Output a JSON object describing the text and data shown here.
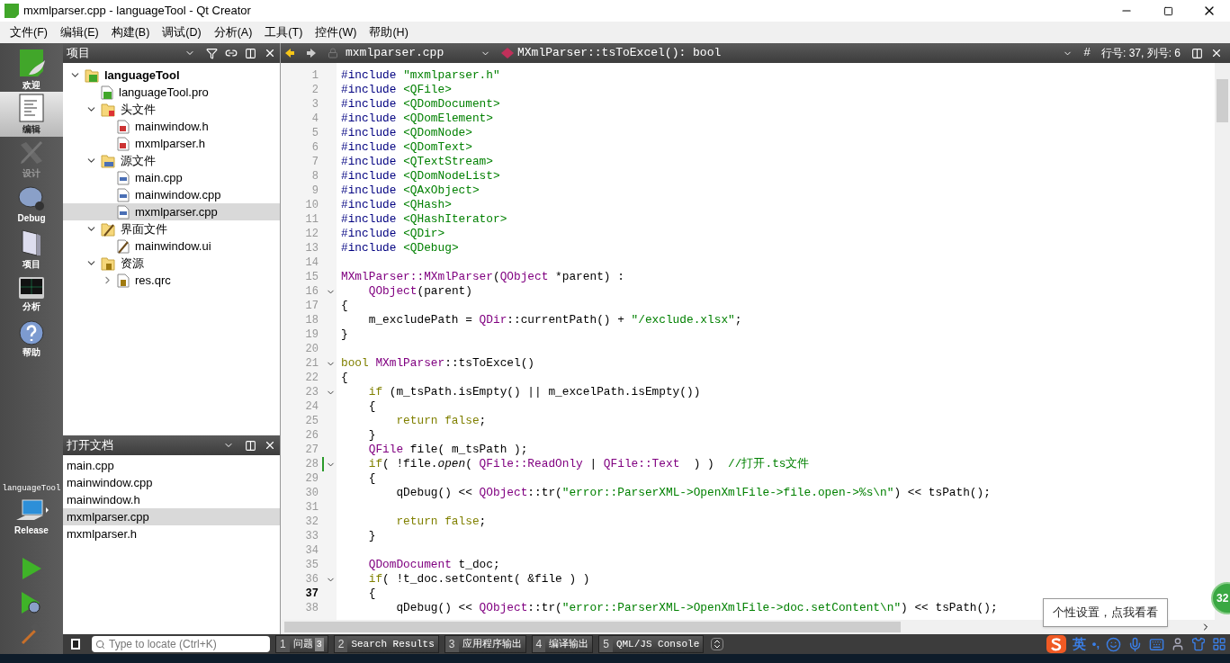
{
  "window": {
    "title": "mxmlparser.cpp - languageTool - Qt Creator"
  },
  "menu": [
    "文件(F)",
    "编辑(E)",
    "构建(B)",
    "调试(D)",
    "分析(A)",
    "工具(T)",
    "控件(W)",
    "帮助(H)"
  ],
  "modes": [
    {
      "label": "欢迎",
      "kind": "welcome",
      "selected": false,
      "disabled": false
    },
    {
      "label": "编辑",
      "kind": "edit",
      "selected": true,
      "disabled": false
    },
    {
      "label": "设计",
      "kind": "design",
      "selected": false,
      "disabled": true
    },
    {
      "label": "Debug",
      "kind": "debug",
      "selected": false,
      "disabled": false
    },
    {
      "label": "项目",
      "kind": "projects",
      "selected": false,
      "disabled": false
    },
    {
      "label": "分析",
      "kind": "analyze",
      "selected": false,
      "disabled": false
    },
    {
      "label": "帮助",
      "kind": "help",
      "selected": false,
      "disabled": false
    }
  ],
  "kit": {
    "project": "languageTool",
    "config": "Release"
  },
  "project_panel": {
    "title": "项目",
    "tree": [
      {
        "label": "languageTool",
        "kind": "project",
        "expanded": true,
        "selected": false,
        "children": [
          {
            "label": "languageTool.pro",
            "kind": "pro",
            "selected": false
          },
          {
            "label": "头文件",
            "kind": "headers",
            "expanded": true,
            "selected": false,
            "children": [
              {
                "label": "mainwindow.h",
                "kind": "h",
                "selected": false
              },
              {
                "label": "mxmlparser.h",
                "kind": "h",
                "selected": false
              }
            ]
          },
          {
            "label": "源文件",
            "kind": "sources",
            "expanded": true,
            "selected": false,
            "children": [
              {
                "label": "main.cpp",
                "kind": "cpp",
                "selected": false
              },
              {
                "label": "mainwindow.cpp",
                "kind": "cpp",
                "selected": false
              },
              {
                "label": "mxmlparser.cpp",
                "kind": "cpp",
                "selected": true
              }
            ]
          },
          {
            "label": "界面文件",
            "kind": "forms",
            "expanded": true,
            "selected": false,
            "children": [
              {
                "label": "mainwindow.ui",
                "kind": "ui",
                "selected": false
              }
            ]
          },
          {
            "label": "资源",
            "kind": "resources",
            "expanded": true,
            "selected": false,
            "children": [
              {
                "label": "res.qrc",
                "kind": "qrc",
                "expanded": false,
                "selected": false
              }
            ]
          }
        ]
      }
    ]
  },
  "open_documents": {
    "title": "打开文档",
    "items": [
      {
        "label": "main.cpp",
        "selected": false
      },
      {
        "label": "mainwindow.cpp",
        "selected": false
      },
      {
        "label": "mainwindow.h",
        "selected": false
      },
      {
        "label": "mxmlparser.cpp",
        "selected": true
      },
      {
        "label": "mxmlparser.h",
        "selected": false
      }
    ]
  },
  "editor": {
    "file": "mxmlparser.cpp",
    "symbol": "MXmlParser::tsToExcel(): bool",
    "hash": "#",
    "position": "行号: 37, 列号: 6",
    "lines": [
      {
        "n": "1",
        "fold": false,
        "current": false,
        "changed": false,
        "tokens": [
          {
            "kind": "pp",
            "t": "#include "
          },
          {
            "kind": "str",
            "t": "\"mxmlparser.h\""
          }
        ]
      },
      {
        "n": "2",
        "fold": false,
        "current": false,
        "changed": false,
        "tokens": [
          {
            "kind": "pp",
            "t": "#include "
          },
          {
            "kind": "str",
            "t": "<QFile>"
          }
        ]
      },
      {
        "n": "3",
        "fold": false,
        "current": false,
        "changed": false,
        "tokens": [
          {
            "kind": "pp",
            "t": "#include "
          },
          {
            "kind": "str",
            "t": "<QDomDocument>"
          }
        ]
      },
      {
        "n": "4",
        "fold": false,
        "current": false,
        "changed": false,
        "tokens": [
          {
            "kind": "pp",
            "t": "#include "
          },
          {
            "kind": "str",
            "t": "<QDomElement>"
          }
        ]
      },
      {
        "n": "5",
        "fold": false,
        "current": false,
        "changed": false,
        "tokens": [
          {
            "kind": "pp",
            "t": "#include "
          },
          {
            "kind": "str",
            "t": "<QDomNode>"
          }
        ]
      },
      {
        "n": "6",
        "fold": false,
        "current": false,
        "changed": false,
        "tokens": [
          {
            "kind": "pp",
            "t": "#include "
          },
          {
            "kind": "str",
            "t": "<QDomText>"
          }
        ]
      },
      {
        "n": "7",
        "fold": false,
        "current": false,
        "changed": false,
        "tokens": [
          {
            "kind": "pp",
            "t": "#include "
          },
          {
            "kind": "str",
            "t": "<QTextStream>"
          }
        ]
      },
      {
        "n": "8",
        "fold": false,
        "current": false,
        "changed": false,
        "tokens": [
          {
            "kind": "pp",
            "t": "#include "
          },
          {
            "kind": "str",
            "t": "<QDomNodeList>"
          }
        ]
      },
      {
        "n": "9",
        "fold": false,
        "current": false,
        "changed": false,
        "tokens": [
          {
            "kind": "pp",
            "t": "#include "
          },
          {
            "kind": "str",
            "t": "<QAxObject>"
          }
        ]
      },
      {
        "n": "10",
        "fold": false,
        "current": false,
        "changed": false,
        "tokens": [
          {
            "kind": "pp",
            "t": "#include "
          },
          {
            "kind": "str",
            "t": "<QHash>"
          }
        ]
      },
      {
        "n": "11",
        "fold": false,
        "current": false,
        "changed": false,
        "tokens": [
          {
            "kind": "pp",
            "t": "#include "
          },
          {
            "kind": "str",
            "t": "<QHashIterator>"
          }
        ]
      },
      {
        "n": "12",
        "fold": false,
        "current": false,
        "changed": false,
        "tokens": [
          {
            "kind": "pp",
            "t": "#include "
          },
          {
            "kind": "str",
            "t": "<QDir>"
          }
        ]
      },
      {
        "n": "13",
        "fold": false,
        "current": false,
        "changed": false,
        "tokens": [
          {
            "kind": "pp",
            "t": "#include "
          },
          {
            "kind": "str",
            "t": "<QDebug>"
          }
        ]
      },
      {
        "n": "14",
        "fold": false,
        "current": false,
        "changed": false
      },
      {
        "n": "15",
        "fold": false,
        "current": false,
        "changed": false,
        "tokens": [
          {
            "kind": "type",
            "t": "MXmlParser::MXmlParser"
          },
          {
            "kind": "plain",
            "t": "("
          },
          {
            "kind": "type",
            "t": "QObject"
          },
          {
            "kind": "plain",
            "t": " *parent) :"
          }
        ]
      },
      {
        "n": "16",
        "fold": true,
        "current": false,
        "changed": false,
        "tokens": [
          {
            "kind": "type",
            "t": "    QObject"
          },
          {
            "kind": "plain",
            "t": "(parent)"
          }
        ]
      },
      {
        "n": "17",
        "fold": false,
        "current": false,
        "changed": false,
        "tokens": [
          {
            "kind": "plain",
            "t": "{"
          }
        ]
      },
      {
        "n": "18",
        "fold": false,
        "current": false,
        "changed": false,
        "tokens": [
          {
            "kind": "plain",
            "t": "    m_excludePath = "
          },
          {
            "kind": "type",
            "t": "QDir"
          },
          {
            "kind": "plain",
            "t": "::currentPath() + "
          },
          {
            "kind": "str",
            "t": "\"/exclude.xlsx\""
          },
          {
            "kind": "plain",
            "t": ";"
          }
        ]
      },
      {
        "n": "19",
        "fold": false,
        "current": false,
        "changed": false,
        "tokens": [
          {
            "kind": "plain",
            "t": "}"
          }
        ]
      },
      {
        "n": "20",
        "fold": false,
        "current": false,
        "changed": false
      },
      {
        "n": "21",
        "fold": true,
        "current": false,
        "changed": false,
        "tokens": [
          {
            "kind": "kw",
            "t": "bool "
          },
          {
            "kind": "type",
            "t": "MXmlParser"
          },
          {
            "kind": "plain",
            "t": "::tsToExcel()"
          }
        ]
      },
      {
        "n": "22",
        "fold": false,
        "current": false,
        "changed": false,
        "tokens": [
          {
            "kind": "plain",
            "t": "{"
          }
        ]
      },
      {
        "n": "23",
        "fold": true,
        "current": false,
        "changed": false,
        "tokens": [
          {
            "kind": "kw",
            "t": "    if"
          },
          {
            "kind": "plain",
            "t": " (m_tsPath.isEmpty() || m_excelPath.isEmpty())"
          }
        ]
      },
      {
        "n": "24",
        "fold": false,
        "current": false,
        "changed": false,
        "tokens": [
          {
            "kind": "plain",
            "t": "    {"
          }
        ]
      },
      {
        "n": "25",
        "fold": false,
        "current": false,
        "changed": false,
        "tokens": [
          {
            "kind": "kw",
            "t": "        return false"
          },
          {
            "kind": "plain",
            "t": ";"
          }
        ]
      },
      {
        "n": "26",
        "fold": false,
        "current": false,
        "changed": false,
        "tokens": [
          {
            "kind": "plain",
            "t": "    }"
          }
        ]
      },
      {
        "n": "27",
        "fold": false,
        "current": false,
        "changed": false,
        "tokens": [
          {
            "kind": "type",
            "t": "    QFile"
          },
          {
            "kind": "plain",
            "t": " file( m_tsPath );"
          }
        ]
      },
      {
        "n": "28",
        "fold": true,
        "current": false,
        "changed": true,
        "tokens": [
          {
            "kind": "kw",
            "t": "    if"
          },
          {
            "kind": "plain",
            "t": "( !file."
          },
          {
            "kind": "italic",
            "t": "open"
          },
          {
            "kind": "plain",
            "t": "( "
          },
          {
            "kind": "type",
            "t": "QFile::ReadOnly"
          },
          {
            "kind": "plain",
            "t": " | "
          },
          {
            "kind": "type",
            "t": "QFile::Text"
          },
          {
            "kind": "plain",
            "t": "  ) )  "
          },
          {
            "kind": "comment",
            "t": "//打开.ts文件"
          }
        ]
      },
      {
        "n": "29",
        "fold": false,
        "current": false,
        "changed": false,
        "tokens": [
          {
            "kind": "plain",
            "t": "    {"
          }
        ]
      },
      {
        "n": "30",
        "fold": false,
        "current": false,
        "changed": false,
        "tokens": [
          {
            "kind": "plain",
            "t": "        qDebug() << "
          },
          {
            "kind": "type",
            "t": "QObject"
          },
          {
            "kind": "plain",
            "t": "::tr("
          },
          {
            "kind": "str",
            "t": "\"error::ParserXML->OpenXmlFile->file.open->%s\\n\""
          },
          {
            "kind": "plain",
            "t": ") << tsPath();"
          }
        ]
      },
      {
        "n": "31",
        "fold": false,
        "current": false,
        "changed": false
      },
      {
        "n": "32",
        "fold": false,
        "current": false,
        "changed": false,
        "tokens": [
          {
            "kind": "kw",
            "t": "        return false"
          },
          {
            "kind": "plain",
            "t": ";"
          }
        ]
      },
      {
        "n": "33",
        "fold": false,
        "current": false,
        "changed": false,
        "tokens": [
          {
            "kind": "plain",
            "t": "    }"
          }
        ]
      },
      {
        "n": "34",
        "fold": false,
        "current": false,
        "changed": false
      },
      {
        "n": "35",
        "fold": false,
        "current": false,
        "changed": false,
        "tokens": [
          {
            "kind": "type",
            "t": "    QDomDocument"
          },
          {
            "kind": "plain",
            "t": " t_doc;"
          }
        ]
      },
      {
        "n": "36",
        "fold": true,
        "current": false,
        "changed": false,
        "tokens": [
          {
            "kind": "kw",
            "t": "    if"
          },
          {
            "kind": "plain",
            "t": "( !t_doc.setContent( &file ) )"
          }
        ]
      },
      {
        "n": "37",
        "fold": false,
        "current": true,
        "changed": false,
        "tokens": [
          {
            "kind": "plain",
            "t": "    {"
          }
        ]
      },
      {
        "n": "38",
        "fold": false,
        "current": false,
        "changed": false,
        "tokens": [
          {
            "kind": "plain",
            "t": "        qDebug() << "
          },
          {
            "kind": "type",
            "t": "QObject"
          },
          {
            "kind": "plain",
            "t": "::tr("
          },
          {
            "kind": "str",
            "t": "\"error::ParserXML->OpenXmlFile->doc.setContent\\n\""
          },
          {
            "kind": "plain",
            "t": ") << tsPath();"
          }
        ]
      }
    ]
  },
  "status_bar": {
    "locate_placeholder": "Type to locate (Ctrl+K)",
    "panes": [
      {
        "number": "1",
        "label": "问题",
        "badge": "3"
      },
      {
        "number": "2",
        "label": "Search Results"
      },
      {
        "number": "3",
        "label": "应用程序输出"
      },
      {
        "number": "4",
        "label": "编译输出"
      },
      {
        "number": "5",
        "label": "QML/JS Console"
      }
    ]
  },
  "ime": {
    "language": "英",
    "punctuation": "•,"
  },
  "tooltip": "个性设置，点我看看",
  "notification_badge": "32"
}
